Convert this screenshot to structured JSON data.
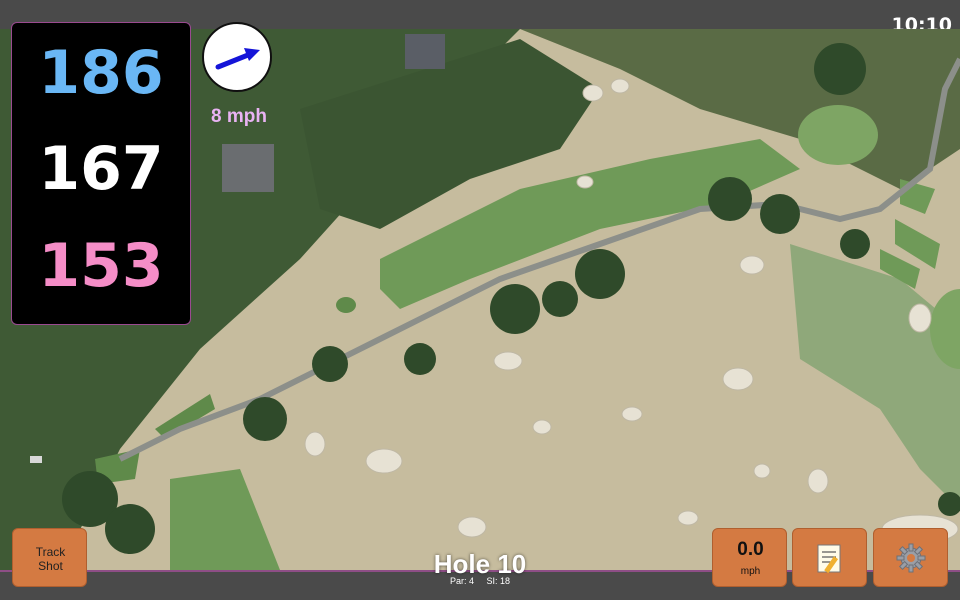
{
  "status": {
    "time": "10:10"
  },
  "distances": {
    "back": "186",
    "center": "167",
    "front": "153"
  },
  "wind": {
    "speed": "8 mph",
    "arrow_icon": "wind-direction-arrow"
  },
  "hole": {
    "title": "Hole 10",
    "par": "Par: 4",
    "stroke_index": "SI: 18"
  },
  "buttons": {
    "track_shot": "Track\nShot",
    "speed_value": "0.0",
    "speed_unit": "mph",
    "notes_icon": "notepad-icon",
    "settings_icon": "gear-icon"
  },
  "colors": {
    "back_distance": "#6ab7f5",
    "center_distance": "#ffffff",
    "front_distance": "#f58dc7",
    "button": "#d47a42",
    "accent_border": "#8e4e86",
    "wind_text": "#e9b3f3"
  }
}
